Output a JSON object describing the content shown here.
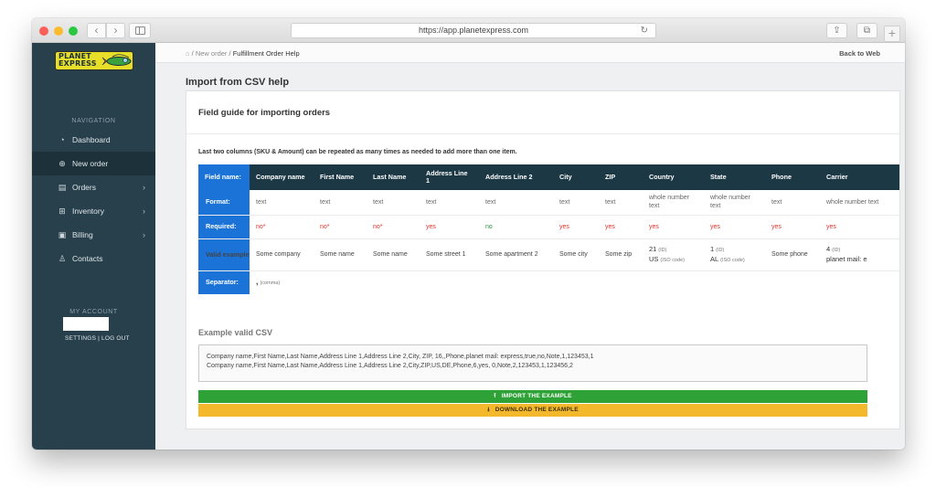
{
  "browser": {
    "url": "https://app.planetexpress.com",
    "back_glyph": "‹",
    "forward_glyph": "›",
    "reload_glyph": "↻",
    "share_glyph": "⇪",
    "tabs_glyph": "⧉",
    "new_tab_glyph": "+"
  },
  "sidebar": {
    "logo_text": "PLANET EXPRESS",
    "nav_header": "NAVIGATION",
    "items": [
      {
        "label": "Dashboard",
        "icon": "gauge-icon",
        "glyph": "◔",
        "active": false,
        "has_children": false
      },
      {
        "label": "New order",
        "icon": "plus-circle-icon",
        "glyph": "⊕",
        "active": true,
        "has_children": false
      },
      {
        "label": "Orders",
        "icon": "clipboard-icon",
        "glyph": "▤",
        "active": false,
        "has_children": true
      },
      {
        "label": "Inventory",
        "icon": "boxes-icon",
        "glyph": "⊞",
        "active": false,
        "has_children": true
      },
      {
        "label": "Billing",
        "icon": "wallet-icon",
        "glyph": "▣",
        "active": false,
        "has_children": true
      },
      {
        "label": "Contacts",
        "icon": "user-icon",
        "glyph": "♙",
        "active": false,
        "has_children": false
      }
    ],
    "chevron_glyph": "›",
    "account_header": "MY ACCOUNT",
    "settings_label": "SETTINGS",
    "separator": "|",
    "logout_label": "LOG OUT"
  },
  "topbar": {
    "home_glyph": "⌂",
    "crumb_sep": "/",
    "crumb_new_order": "New order",
    "crumb_current": "Fulfillment Order Help",
    "back_label": "Back to Web"
  },
  "page": {
    "title": "Import from CSV help",
    "card_title": "Field guide for importing orders",
    "note": "Last two columns (SKU & Amount) can be repeated as many times as needed to add more than one item."
  },
  "guide": {
    "corner_label": "Field name:",
    "columns": [
      "Company name",
      "First Name",
      "Last Name",
      "Address Line 1",
      "Address Line 2",
      "City",
      "ZIP",
      "Country",
      "State",
      "Phone",
      "Carrier"
    ],
    "row_labels": {
      "format": "Format:",
      "required": "Required:",
      "valid": "Valid examples:",
      "separator": "Separator:"
    },
    "format": [
      "text",
      "text",
      "text",
      "text",
      "text",
      "text",
      "text",
      "whole number text",
      "whole number text",
      "text",
      "whole number text"
    ],
    "required": [
      "no*",
      "no*",
      "no*",
      "yes",
      "no",
      "yes",
      "yes",
      "yes",
      "yes",
      "yes",
      "yes"
    ],
    "valid_simple": [
      "Some company",
      "Some name",
      "Some name",
      "Some street 1",
      "Some apartment 2",
      "Some city",
      "Some zip"
    ],
    "valid_country": {
      "line1": "21",
      "line1_note": "(ID)",
      "line2": "US",
      "line2_note": "(ISO code)"
    },
    "valid_state": {
      "line1": "1",
      "line1_note": "(ID)",
      "line2": "AL",
      "line2_note": "(ISO code)"
    },
    "valid_phone": "Some phone",
    "valid_carrier": {
      "line1": "4",
      "line1_note": "(ID)",
      "line2": "planet mail: e"
    },
    "separator_value": ",",
    "separator_note": "(comma)"
  },
  "csv": {
    "label": "Example valid CSV",
    "line1": "Company name,First Name,Last Name,Address Line 1,Address Line 2,City, ZIP, 16,,Phone,planet mail: express,true,no,Note,1,123453,1",
    "line2": "Company name,First Name,Last Name,Address Line 1,Address Line 2,City,ZIP,US,DE,Phone,6,yes, 0,Note,2,123453,1,123456,2"
  },
  "buttons": {
    "import_label": "IMPORT THE EXAMPLE",
    "download_label": "DOWNLOAD THE EXAMPLE",
    "import_icon": "upload-icon",
    "download_icon": "download-icon",
    "import_color": "#2ea137",
    "download_color": "#f4b82d"
  },
  "colors": {
    "sidebar_bg": "#27404c",
    "table_header": "#1c3844",
    "row_header": "#1b73d7",
    "required_red": "#e0322d",
    "optional_green": "#2e9a3b"
  }
}
